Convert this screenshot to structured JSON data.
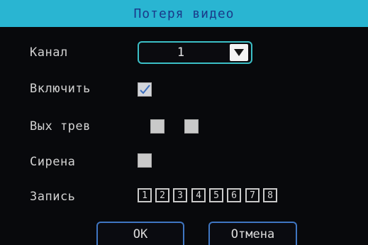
{
  "window": {
    "title": "Потеря видео"
  },
  "form": {
    "channel": {
      "label": "Канал",
      "value": "1"
    },
    "enable": {
      "label": "Включить",
      "checked": true
    },
    "alarm_out": {
      "label": "Вых трев",
      "checked": [
        false,
        false
      ]
    },
    "siren": {
      "label": "Сирена",
      "checked": false
    },
    "record": {
      "label": "Запись",
      "channels": [
        "1",
        "2",
        "3",
        "4",
        "5",
        "6",
        "7",
        "8"
      ]
    }
  },
  "buttons": {
    "ok": "ОК",
    "cancel": "Отмена"
  },
  "colors": {
    "title_bar": "#29b5d2",
    "title_text": "#1a3a8a",
    "accent_border": "#3bbfc6",
    "button_border": "#3f76c2",
    "background": "#08090c"
  },
  "icons": {
    "dropdown": "triangle-down-icon",
    "check": "check-icon"
  }
}
